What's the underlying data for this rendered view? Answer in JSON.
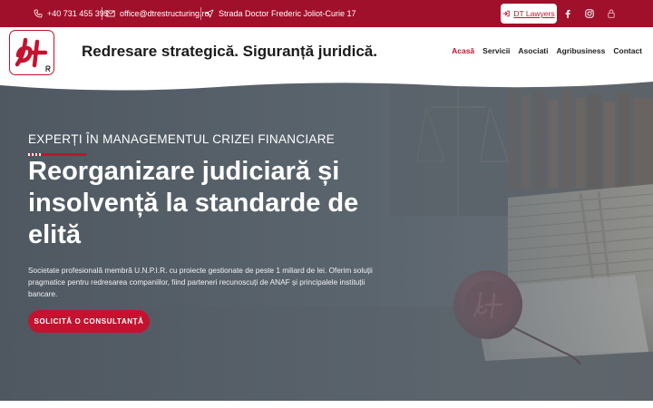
{
  "topbar": {
    "phone": "+40 731 455 395",
    "email": "office@dtrestructuring.ro",
    "address": "Strada Doctor Frederic Joliot-Curie 17",
    "dt_lawyers_label": "DT Lawyers",
    "facebook_icon": "facebook-icon",
    "instagram_icon": "instagram-icon",
    "lock_icon": "lock-icon"
  },
  "header": {
    "tagline": "Redresare strategică. Siguranță juridică.",
    "nav": [
      {
        "label": "Acasă",
        "active": true
      },
      {
        "label": "Servicii",
        "active": false
      },
      {
        "label": "Asociati",
        "active": false
      },
      {
        "label": "Agribusiness",
        "active": false
      },
      {
        "label": "Contact",
        "active": false
      }
    ]
  },
  "hero": {
    "eyebrow": "EXPERȚI ÎN MANAGEMENTUL CRIZEI FINANCIARE",
    "headline": "Reorganizare judiciară și insolvență la standarde de elită",
    "description": "Societate profesională membră U.N.P.I.R. cu proiecte gestionate de peste 1 miliard de lei. Oferim soluții pragmatice pentru redresarea companiilor, fiind parteneri recunoscuți de ANAF și principalele instituții bancare.",
    "cta_label": "SOLICITĂ O CONSULTANȚĂ"
  },
  "colors": {
    "brand_red": "#c4122f",
    "topbar_bg": "#a1102b",
    "hero_overlay": "#5c6670"
  }
}
